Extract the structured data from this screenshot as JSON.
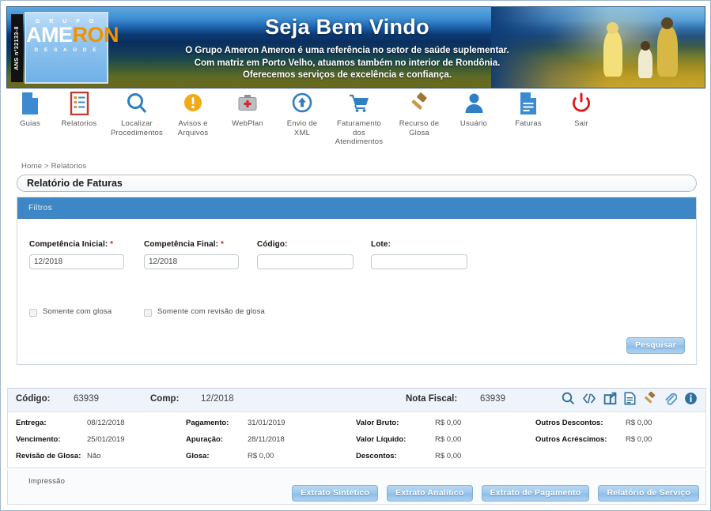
{
  "banner": {
    "ans_tag": "ANS nº32133-8",
    "logo": {
      "top": "G R U P O",
      "white_part": "AME",
      "orange_part": "RON",
      "bottom": "D E   S A Ú D E"
    },
    "title": "Seja Bem Vindo",
    "lines": [
      "O Grupo Ameron Ameron é uma referência no setor de saúde suplementar.",
      "Com matriz em Porto Velho, atuamos também no interior de Rondônia.",
      "Oferecemos serviços de excelência e confiança."
    ]
  },
  "nav": {
    "items": [
      {
        "label": "Guias",
        "icon": "document-icon"
      },
      {
        "label": "Relatorios",
        "icon": "list-report-icon"
      },
      {
        "label": "Localizar\nProcedimentos",
        "icon": "search-icon"
      },
      {
        "label": "Avisos e\nArquivos",
        "icon": "warning-icon"
      },
      {
        "label": "WebPlan",
        "icon": "medical-kit-icon"
      },
      {
        "label": "Envio de\nXML",
        "icon": "upload-arrow-icon"
      },
      {
        "label": "Faturamento\ndos\nAtendimentos",
        "icon": "shopping-cart-icon"
      },
      {
        "label": "Recurso de\nGlosa",
        "icon": "gavel-icon"
      },
      {
        "label": "Usuário",
        "icon": "user-icon"
      },
      {
        "label": "Faturas",
        "icon": "invoice-icon"
      },
      {
        "label": "Sair",
        "icon": "power-off-icon"
      }
    ]
  },
  "breadcrumb": {
    "home": "Home",
    "separator": ">",
    "current": "Relatorios"
  },
  "page_title": "Relatório de Faturas",
  "filters": {
    "header": "Filtros",
    "fields": [
      {
        "label": "Competência Inicial:",
        "required": true,
        "value": "12/2018",
        "placeholder": ""
      },
      {
        "label": "Competência Final:",
        "required": true,
        "value": "12/2018",
        "placeholder": ""
      },
      {
        "label": "Código:",
        "required": false,
        "value": "",
        "placeholder": ""
      },
      {
        "label": "Lote:",
        "required": false,
        "value": "",
        "placeholder": ""
      }
    ],
    "checkboxes": [
      {
        "label": "Somente com glosa",
        "checked": false
      },
      {
        "label": "Somente com revisão de glosa",
        "checked": false
      }
    ],
    "search_button": "Pesquisar"
  },
  "result": {
    "header": {
      "codigo_label": "Código:",
      "codigo_value": "63939",
      "comp_label": "Comp:",
      "comp_value": "12/2018",
      "nota_label": "Nota Fiscal:",
      "nota_value": "63939",
      "icons": [
        "search-icon",
        "code-brackets-icon",
        "external-link-icon",
        "document-lines-icon",
        "gavel-icon",
        "paperclip-icon",
        "info-icon"
      ]
    },
    "col1": [
      {
        "label": "Entrega:",
        "value": "08/12/2018"
      },
      {
        "label": "Vencimento:",
        "value": "25/01/2019"
      },
      {
        "label": "Revisão de Glosa:",
        "value": "Não"
      }
    ],
    "col2": [
      {
        "label": "Pagamento:",
        "value": "31/01/2019"
      },
      {
        "label": "Apuração:",
        "value": "28/11/2018"
      },
      {
        "label": "Glosa:",
        "value": "R$ 0,00"
      }
    ],
    "col3": [
      {
        "label": "Valor Bruto:",
        "value": "R$ 0,00"
      },
      {
        "label": "Valor Líquido:",
        "value": "R$ 0,00"
      },
      {
        "label": "Descontos:",
        "value": "R$ 0,00"
      }
    ],
    "col4": [
      {
        "label": "Outros Descontos:",
        "value": "R$ 0,00"
      },
      {
        "label": "Outros Acréscimos:",
        "value": "R$ 0,00"
      }
    ]
  },
  "footer": {
    "label": "Impressão",
    "buttons": [
      "Extrato Sintético",
      "Extrato Analítico",
      "Extrato de Pagamento",
      "Relatório de Serviço"
    ]
  },
  "colors": {
    "panel_header": "#3d87c6",
    "required_star": "#cc2222",
    "button_blue": "#9cc7ec",
    "logo_orange": "#f39200",
    "result_header_bg": "#eef4fa"
  }
}
